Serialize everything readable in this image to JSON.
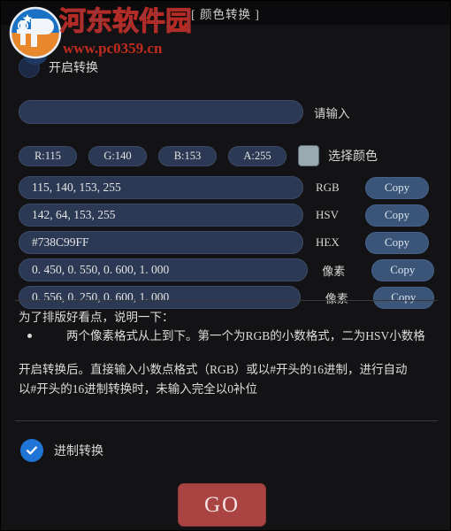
{
  "window": {
    "title": "[ 颜色转换 ]"
  },
  "watermark": {
    "site_name": "河东软件园",
    "url": "www.pc0359.cn",
    "logo_icon": "hedong-logo-icon",
    "brand_blue": "#1b72c4",
    "brand_red": "#c22b1f",
    "brand_orange": "#e8872b"
  },
  "enable_convert": {
    "label": "开启转换",
    "checked": false
  },
  "main_input": {
    "value": "",
    "placeholder": "",
    "side_label": "请输入"
  },
  "channels": [
    {
      "label": "R:115"
    },
    {
      "label": "G:140"
    },
    {
      "label": "B:153"
    },
    {
      "label": "A:255"
    }
  ],
  "color_picker": {
    "label": "选择颜色",
    "swatch_color": "#99aab0"
  },
  "values": [
    {
      "value": "115, 140, 153, 255",
      "tag": "RGB",
      "copy_label": "Copy"
    },
    {
      "value": "142, 64, 153, 255",
      "tag": "HSV",
      "copy_label": "Copy"
    },
    {
      "value": "#738C99FF",
      "tag": "HEX",
      "copy_label": "Copy"
    },
    {
      "value": "0. 450, 0. 550, 0. 600, 1. 000",
      "tag": "像素",
      "copy_label": "Copy"
    },
    {
      "value": "0. 556, 0. 250, 0. 600, 1. 000",
      "tag": "像素",
      "copy_label": "Copy"
    }
  ],
  "notes": {
    "heading": "为了排版好看点，说明一下：",
    "bullet": "两个像素格式从上到下。第一个为RGB的小数格式，二为HSV小数格"
  },
  "paragraph": {
    "line1": "开启转换后。直接输入小数点格式（RGB）或以#开头的16进制，进行自动",
    "line2": "以#开头的16进制转换时，未输入完全以0补位"
  },
  "base_convert": {
    "label": "进制转换",
    "checked": true,
    "check_color": "#1f74d6"
  },
  "go_button": {
    "label": "GO",
    "color": "#a94442"
  }
}
